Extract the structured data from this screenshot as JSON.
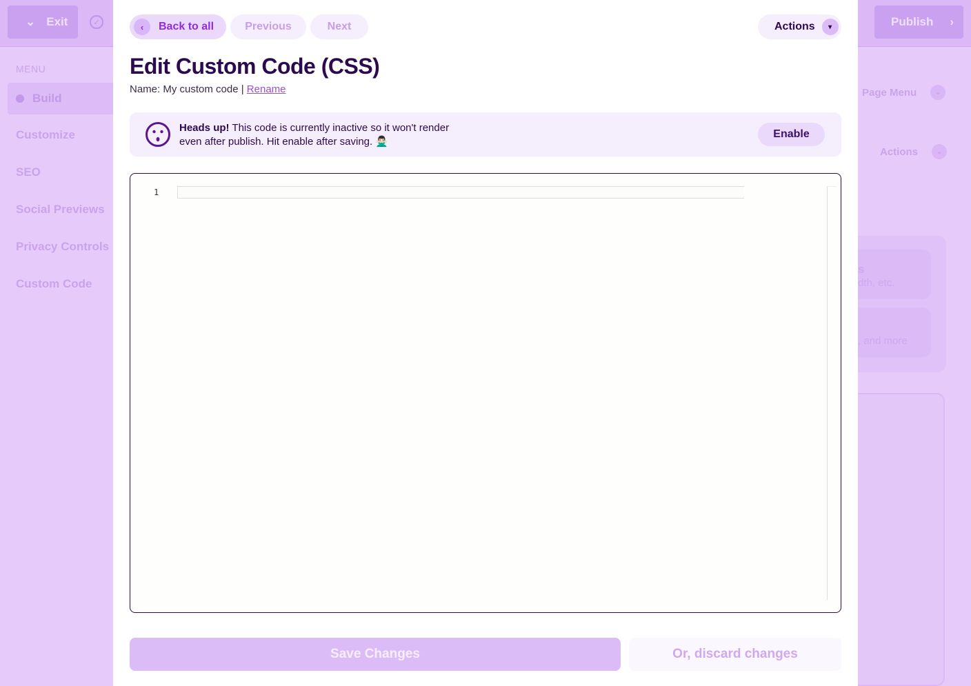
{
  "background": {
    "exit_label": "Exit",
    "publish_label": "Publish",
    "menu_heading": "MENU",
    "nav_items": [
      "Build",
      "Customize",
      "SEO",
      "Social Previews",
      "Privacy Controls",
      "Custom Code"
    ],
    "page_menu_label": "Page Menu",
    "actions_label": "Actions",
    "card1_fragment_title": "s",
    "card1_fragment_text": "dth, etc.",
    "card2_fragment_text": ", and more"
  },
  "modal": {
    "nav": {
      "back_label": "Back to all",
      "previous_label": "Previous",
      "next_label": "Next",
      "actions_label": "Actions"
    },
    "title": "Edit Custom Code (CSS)",
    "name_prefix": "Name: My custom code | ",
    "rename_label": "Rename",
    "notice": {
      "bold": "Heads up!",
      "text": " This code is currently inactive so it won't render even after publish. Hit enable after saving. 🙅🏻‍♂️",
      "enable_label": "Enable"
    },
    "editor": {
      "line_numbers": [
        "1"
      ],
      "content": ""
    },
    "save_label": "Save Changes",
    "discard_label": "Or, discard changes"
  },
  "colors": {
    "accent": "#8f2ed8",
    "title": "#2b0a4d",
    "overlay": "#e2c6f8"
  }
}
